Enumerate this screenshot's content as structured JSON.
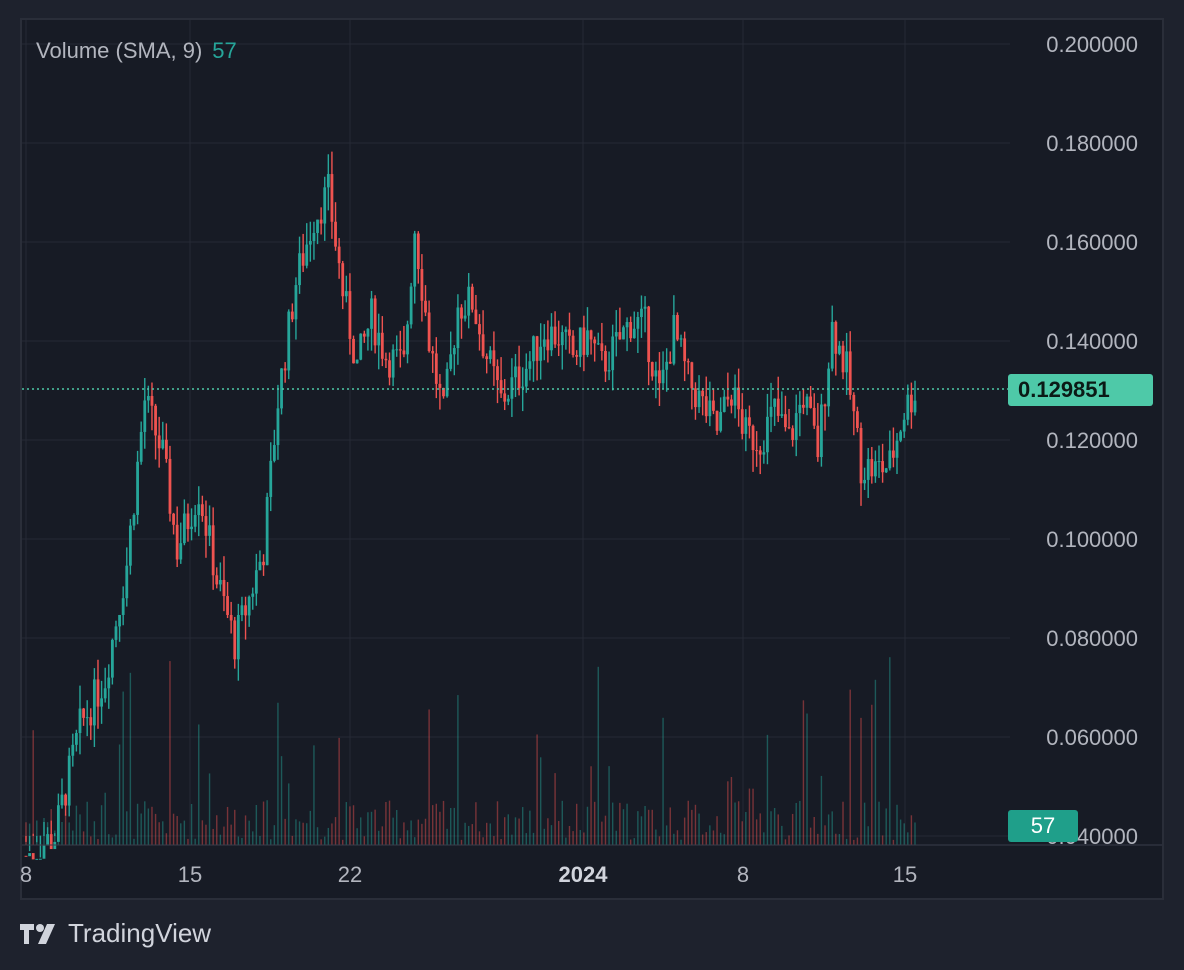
{
  "legend": {
    "indicator": "Volume (SMA, 9)",
    "value": "57"
  },
  "brand": {
    "name": "TradingView"
  },
  "price_tag": "0.129851",
  "volume_tag": "57",
  "colors": {
    "up": "#26a69a",
    "down": "#ef5350",
    "grid": "#262a35",
    "bg": "#171b25",
    "price_line": "#4ec9a8",
    "price_tag_bg": "#4ec9a8",
    "volume_tag_bg": "#1f9f8a"
  },
  "chart_data": {
    "type": "candlestick",
    "y_axis": {
      "ticks": [
        "0.200000",
        "0.180000",
        "0.160000",
        "0.140000",
        "0.120000",
        "0.100000",
        "0.080000",
        "0.060000",
        "0.040000"
      ],
      "range": [
        0.04,
        0.2
      ]
    },
    "x_axis": {
      "ticks": [
        "8",
        "15",
        "22",
        "2024",
        "8",
        "15"
      ],
      "bold_tick": "2024"
    },
    "last_price": 0.129851,
    "grid": true,
    "indicator": "Volume (SMA, 9)",
    "indicator_value": 57
  }
}
